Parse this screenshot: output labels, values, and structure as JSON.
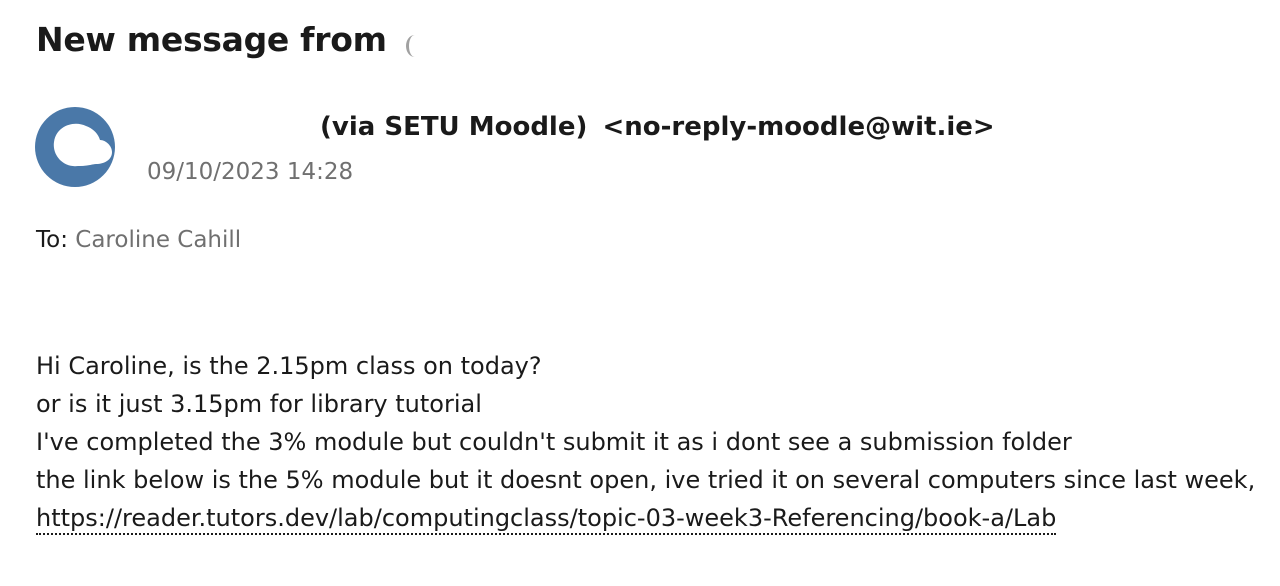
{
  "header": {
    "title": "New message from"
  },
  "sender": {
    "via_label": "(via SETU Moodle)",
    "email": "<no-reply-moodle@wit.ie>",
    "timestamp": "09/10/2023 14:28",
    "avatar_icon": "cloud-logo-icon",
    "avatar_color": "#4a78a8"
  },
  "recipients": {
    "to_label": "To:",
    "to_name": "Caroline Cahill"
  },
  "message": {
    "lines": [
      "Hi Caroline, is the 2.15pm class on today?",
      "or is it just 3.15pm for library tutorial",
      "I've completed the 3% module but couldn't submit it as i dont see a submission folder",
      "the link below is the 5% module but it doesnt open, ive tried it on several computers since last week,"
    ],
    "link": "https://reader.tutors.dev/lab/computingclass/topic-03-week3-Referencing/book-a/Lab"
  }
}
